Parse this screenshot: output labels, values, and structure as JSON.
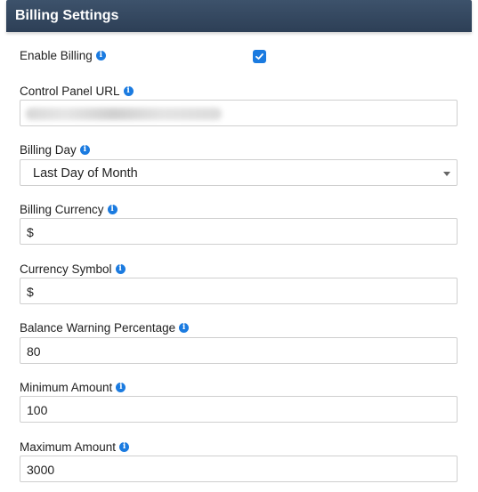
{
  "header": {
    "title": "Billing Settings"
  },
  "fields": {
    "enable_billing": {
      "label": "Enable Billing",
      "checked": true
    },
    "control_panel_url": {
      "label": "Control Panel URL",
      "value": ""
    },
    "billing_day": {
      "label": "Billing Day",
      "value": "Last Day of Month"
    },
    "billing_currency": {
      "label": "Billing Currency",
      "value": "$"
    },
    "currency_symbol": {
      "label": "Currency Symbol",
      "value": "$"
    },
    "balance_warning_percentage": {
      "label": "Balance Warning Percentage",
      "value": "80"
    },
    "minimum_amount": {
      "label": "Minimum Amount",
      "value": "100"
    },
    "maximum_amount": {
      "label": "Maximum Amount",
      "value": "3000"
    }
  },
  "icons": {
    "info": "info-icon",
    "check": "check-icon",
    "dropdown": "chevron-down-icon"
  },
  "colors": {
    "header": "#33475f",
    "accent": "#1b7be0"
  }
}
